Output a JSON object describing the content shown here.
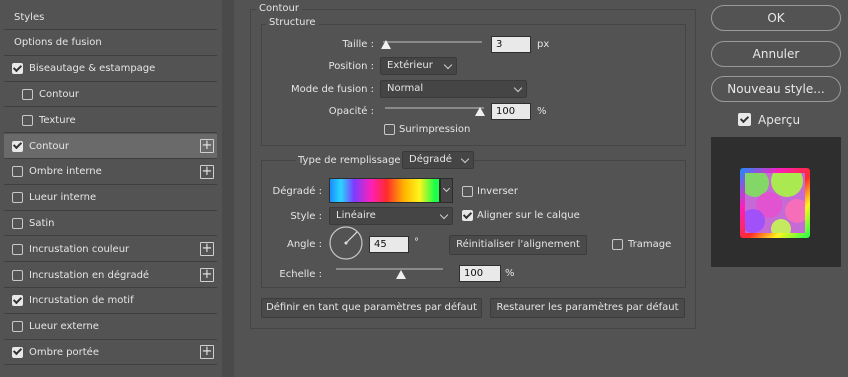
{
  "sidebar": {
    "items": [
      {
        "label": "Styles",
        "checkbox": false,
        "checked": false,
        "plus": false,
        "selected": false,
        "indent": false
      },
      {
        "label": "Options de fusion",
        "checkbox": false,
        "checked": false,
        "plus": false,
        "selected": false,
        "indent": false
      },
      {
        "label": "Biseautage & estampage",
        "checkbox": true,
        "checked": true,
        "plus": false,
        "selected": false,
        "indent": false
      },
      {
        "label": "Contour",
        "checkbox": true,
        "checked": false,
        "plus": false,
        "selected": false,
        "indent": true
      },
      {
        "label": "Texture",
        "checkbox": true,
        "checked": false,
        "plus": false,
        "selected": false,
        "indent": true
      },
      {
        "label": "Contour",
        "checkbox": true,
        "checked": true,
        "plus": true,
        "selected": true,
        "indent": false
      },
      {
        "label": "Ombre interne",
        "checkbox": true,
        "checked": false,
        "plus": true,
        "selected": false,
        "indent": false
      },
      {
        "label": "Lueur interne",
        "checkbox": true,
        "checked": false,
        "plus": false,
        "selected": false,
        "indent": false
      },
      {
        "label": "Satin",
        "checkbox": true,
        "checked": false,
        "plus": false,
        "selected": false,
        "indent": false
      },
      {
        "label": "Incrustation couleur",
        "checkbox": true,
        "checked": false,
        "plus": true,
        "selected": false,
        "indent": false
      },
      {
        "label": "Incrustation en dégradé",
        "checkbox": true,
        "checked": false,
        "plus": true,
        "selected": false,
        "indent": false
      },
      {
        "label": "Incrustation de motif",
        "checkbox": true,
        "checked": true,
        "plus": false,
        "selected": false,
        "indent": false
      },
      {
        "label": "Lueur externe",
        "checkbox": true,
        "checked": false,
        "plus": false,
        "selected": false,
        "indent": false
      },
      {
        "label": "Ombre portée",
        "checkbox": true,
        "checked": true,
        "plus": true,
        "selected": false,
        "indent": false
      }
    ]
  },
  "contour": {
    "title": "Contour",
    "structure": {
      "title": "Structure",
      "taille_label": "Taille :",
      "taille_value": "3",
      "taille_unit": "px",
      "position_label": "Position :",
      "position_value": "Extérieur",
      "mode_label": "Mode de fusion :",
      "mode_value": "Normal",
      "opacite_label": "Opacité :",
      "opacite_value": "100",
      "opacite_unit": "%",
      "surimpression_label": "Surimpression",
      "surimpression_checked": false
    },
    "fill": {
      "type_label": "Type de remplissage :",
      "type_value": "Dégradé",
      "degrade_label": "Dégradé :",
      "inverser_label": "Inverser",
      "inverser_checked": false,
      "style_label": "Style :",
      "style_value": "Linéaire",
      "aligner_label": "Aligner sur le calque",
      "aligner_checked": true,
      "angle_label": "Angle :",
      "angle_value": "45",
      "angle_unit": "°",
      "reset_label": "Réinitialiser l'alignement",
      "tramage_label": "Tramage",
      "tramage_checked": false,
      "echelle_label": "Echelle :",
      "echelle_value": "100",
      "echelle_unit": "%"
    },
    "default_button": "Définir en tant que paramètres par défaut",
    "restore_button": "Restaurer les paramètres par défaut"
  },
  "actions": {
    "ok": "OK",
    "annuler": "Annuler",
    "nouveau_style": "Nouveau style...",
    "apercu_label": "Aperçu",
    "apercu_checked": true
  },
  "colors": {
    "background": "#535353",
    "selected_row": "#6a6a6a",
    "input_bg": "#e9e9e9"
  }
}
